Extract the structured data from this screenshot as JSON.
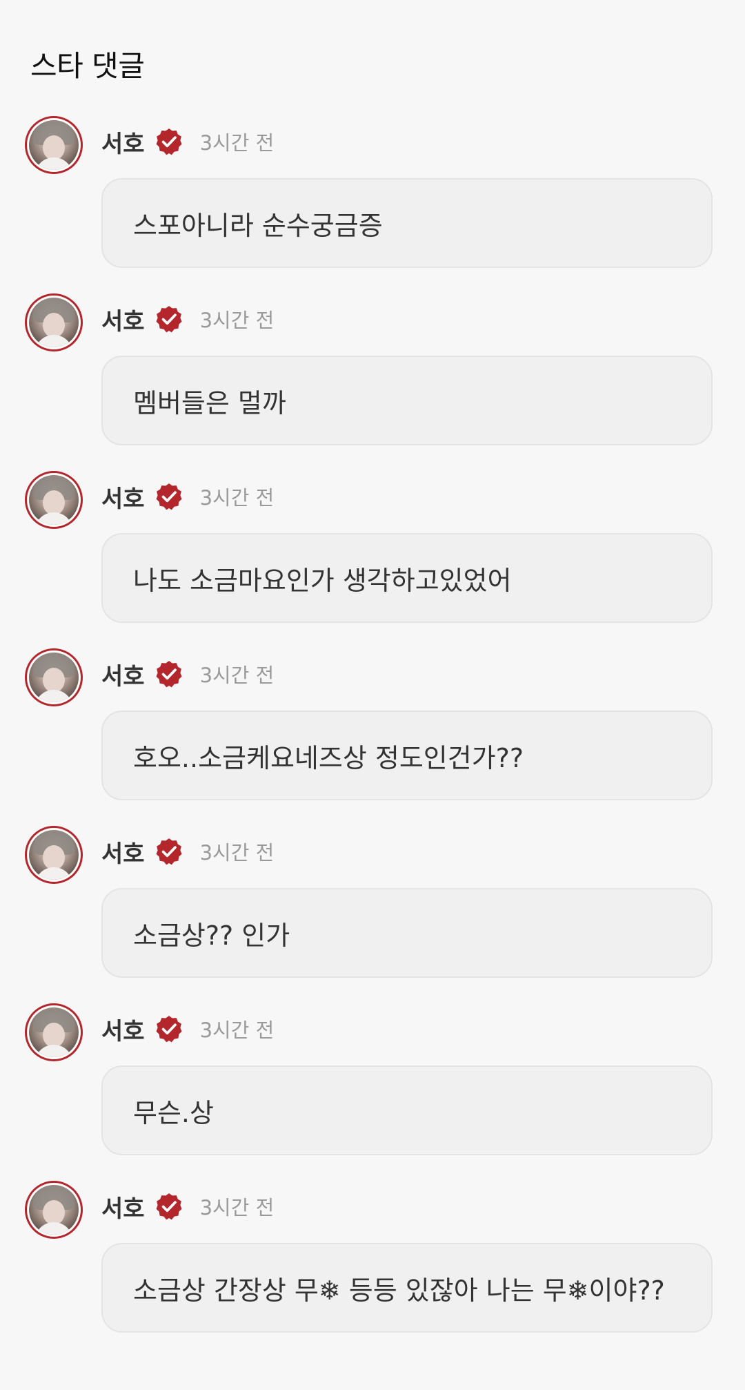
{
  "section": {
    "title": "스타 댓글"
  },
  "colors": {
    "accent": "#b3262c",
    "bubble": "#f0f0f0",
    "background": "#f7f7f7"
  },
  "comments": [
    {
      "author": "서호",
      "verified_icon": "verified-badge-icon",
      "time": "3시간 전",
      "text": "스포아니라 순수궁금증"
    },
    {
      "author": "서호",
      "verified_icon": "verified-badge-icon",
      "time": "3시간 전",
      "text": "멤버들은 멀까"
    },
    {
      "author": "서호",
      "verified_icon": "verified-badge-icon",
      "time": "3시간 전",
      "text": "나도 소금마요인가 생각하고있었어"
    },
    {
      "author": "서호",
      "verified_icon": "verified-badge-icon",
      "time": "3시간 전",
      "text": "호오..소금케요네즈상 정도인건가??"
    },
    {
      "author": "서호",
      "verified_icon": "verified-badge-icon",
      "time": "3시간 전",
      "text": "소금상?? 인가"
    },
    {
      "author": "서호",
      "verified_icon": "verified-badge-icon",
      "time": "3시간 전",
      "text": "무슨.상"
    },
    {
      "author": "서호",
      "verified_icon": "verified-badge-icon",
      "time": "3시간 전",
      "text": "소금상 간장상 무❄ 등등 있잖아 나는 무❄이야??"
    }
  ]
}
